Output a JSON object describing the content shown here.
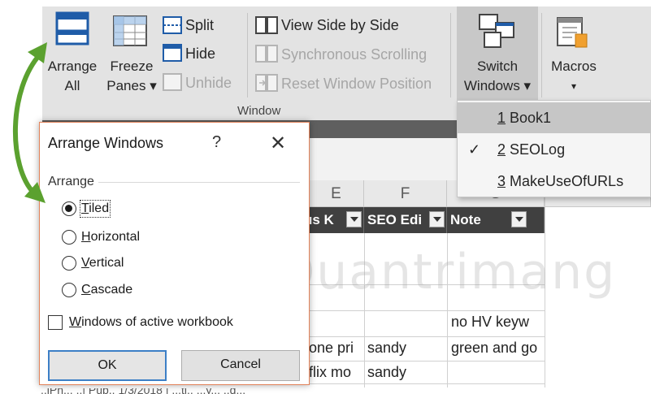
{
  "ribbon": {
    "arrange_all": [
      "Arrange",
      "All"
    ],
    "freeze_panes": [
      "Freeze",
      "Panes ▾"
    ],
    "split": "Split",
    "hide": "Hide",
    "unhide": "Unhide",
    "view_side_by_side": "View Side by Side",
    "synchronous_scrolling": "Synchronous Scrolling",
    "reset_window_position": "Reset Window Position",
    "switch_windows": [
      "Switch",
      "Windows ▾"
    ],
    "macros": [
      "Macros",
      "▾"
    ],
    "group_label": "Window"
  },
  "menu": {
    "items": [
      {
        "num": "1",
        "label": "Book1",
        "checked": false,
        "highlighted": true
      },
      {
        "num": "2",
        "label": "SEOLog",
        "checked": true,
        "highlighted": false
      },
      {
        "num": "3",
        "label": "MakeUseOfURLs",
        "checked": false,
        "highlighted": false
      }
    ],
    "check": "✓"
  },
  "dialog": {
    "title": "Arrange Windows",
    "help": "?",
    "close": "✕",
    "group_label": "Arrange",
    "options": [
      {
        "key": "T",
        "rest": "iled",
        "selected": true
      },
      {
        "key": "H",
        "rest": "orizontal",
        "selected": false
      },
      {
        "key": "V",
        "rest": "ertical",
        "selected": false
      },
      {
        "key": "C",
        "rest": "ascade",
        "selected": false
      }
    ],
    "checkbox": {
      "key": "W",
      "rest": "indows of active workbook",
      "checked": false
    },
    "ok": "OK",
    "cancel": "Cancel"
  },
  "sheet": {
    "columns": [
      "E",
      "F",
      "G"
    ],
    "headers": [
      "us K",
      "SEO Edi",
      "Note"
    ],
    "rows": [
      [
        "",
        "",
        "no HV keyw"
      ],
      [
        "one pri",
        "sandy",
        "green and go"
      ],
      [
        "flix mo",
        "sandy",
        ""
      ]
    ],
    "bottom_fragment": "..iPh... ..| Pub.. 1/3/2018 | ...ti..   ...y...   ..d..."
  },
  "watermark": "Quantrimang",
  "colors": {
    "ribbon_bg": "#e3e3e3",
    "accent_arrow": "#5ba12f",
    "dialog_border": "#e2835a",
    "ok_border": "#3c7fc6"
  }
}
